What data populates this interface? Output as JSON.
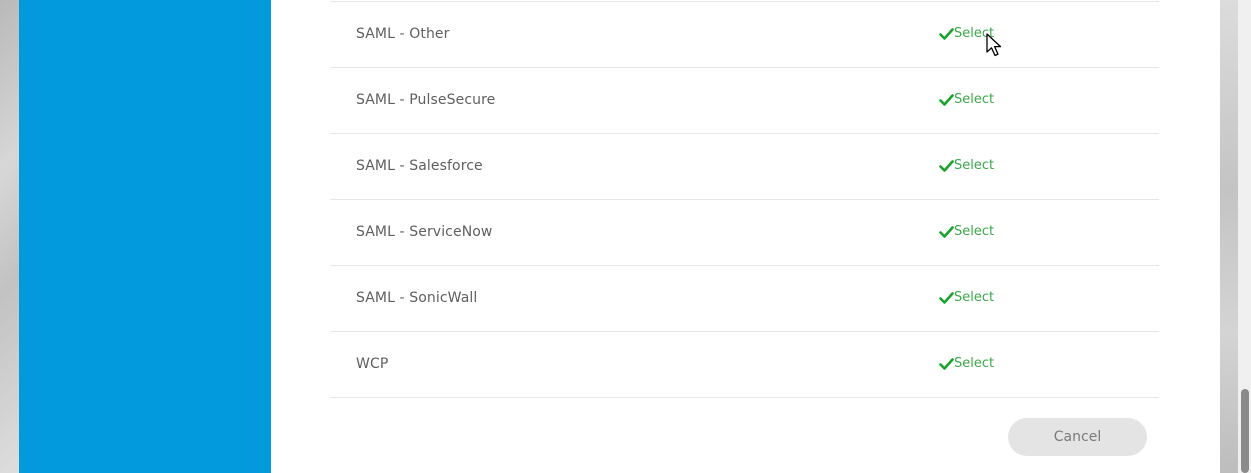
{
  "provider_list": {
    "items": [
      {
        "name": "SAML - Other",
        "action": "Select"
      },
      {
        "name": "SAML - PulseSecure",
        "action": "Select"
      },
      {
        "name": "SAML - Salesforce",
        "action": "Select"
      },
      {
        "name": "SAML - ServiceNow",
        "action": "Select"
      },
      {
        "name": "SAML - SonicWall",
        "action": "Select"
      },
      {
        "name": "WCP",
        "action": "Select"
      }
    ]
  },
  "footer": {
    "cancel_label": "Cancel"
  },
  "colors": {
    "sidebar": "#0399dd",
    "select_green": "#3ca84a",
    "check_green": "#1aa32b"
  },
  "icons": {
    "select": "check-icon",
    "pointer": "mouse-cursor-icon"
  }
}
